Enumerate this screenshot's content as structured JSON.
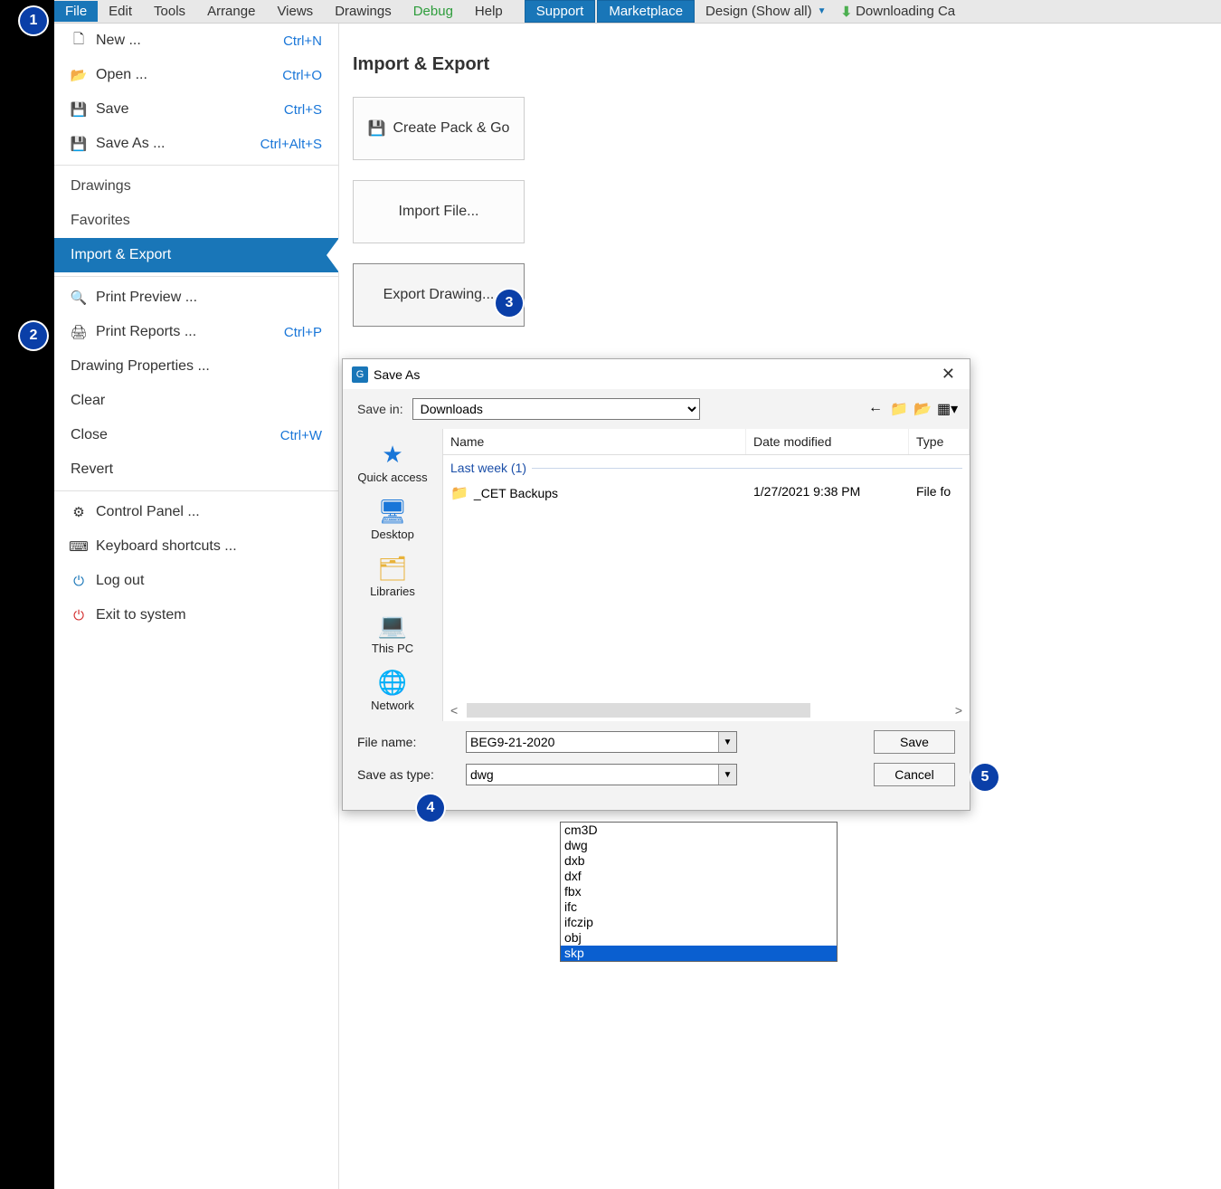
{
  "menubar": {
    "items": [
      "File",
      "Edit",
      "Tools",
      "Arrange",
      "Views",
      "Drawings",
      "Debug",
      "Help"
    ],
    "support": "Support",
    "marketplace": "Marketplace",
    "design_dropdown": "Design (Show all)",
    "downloading": "Downloading Ca"
  },
  "sidebar": {
    "new": "New ...",
    "new_sc": "Ctrl+N",
    "open": "Open ...",
    "open_sc": "Ctrl+O",
    "save": "Save",
    "save_sc": "Ctrl+S",
    "saveas": "Save As ...",
    "saveas_sc": "Ctrl+Alt+S",
    "drawings": "Drawings",
    "favorites": "Favorites",
    "import_export": "Import & Export",
    "print_preview": "Print Preview ...",
    "print_reports": "Print Reports ...",
    "print_reports_sc": "Ctrl+P",
    "drawing_props": "Drawing Properties ...",
    "clear": "Clear",
    "close": "Close",
    "close_sc": "Ctrl+W",
    "revert": "Revert",
    "control_panel": "Control Panel ...",
    "kbd": "Keyboard shortcuts ...",
    "logout": "Log out",
    "exit": "Exit to system"
  },
  "main": {
    "title": "Import & Export",
    "create_pack": "Create Pack & Go",
    "import_file": "Import File...",
    "export_drawing": "Export Drawing..."
  },
  "dialog": {
    "title": "Save As",
    "save_in_label": "Save in:",
    "save_in_value": "Downloads",
    "columns": {
      "name": "Name",
      "date": "Date modified",
      "type": "Type"
    },
    "group": "Last week (1)",
    "file_row": {
      "name": "_CET Backups",
      "date": "1/27/2021 9:38 PM",
      "type": "File fo"
    },
    "places": {
      "quick": "Quick access",
      "desktop": "Desktop",
      "libraries": "Libraries",
      "thispc": "This PC",
      "network": "Network"
    },
    "file_name_label": "File name:",
    "file_name_value": "BEG9-21-2020",
    "save_type_label": "Save as type:",
    "save_type_value": "dwg",
    "save_btn": "Save",
    "cancel_btn": "Cancel"
  },
  "type_options": [
    "cm3D",
    "dwg",
    "dxb",
    "dxf",
    "fbx",
    "ifc",
    "ifczip",
    "obj",
    "skp"
  ],
  "callouts": {
    "1": "1",
    "2": "2",
    "3": "3",
    "4": "4",
    "5": "5"
  }
}
